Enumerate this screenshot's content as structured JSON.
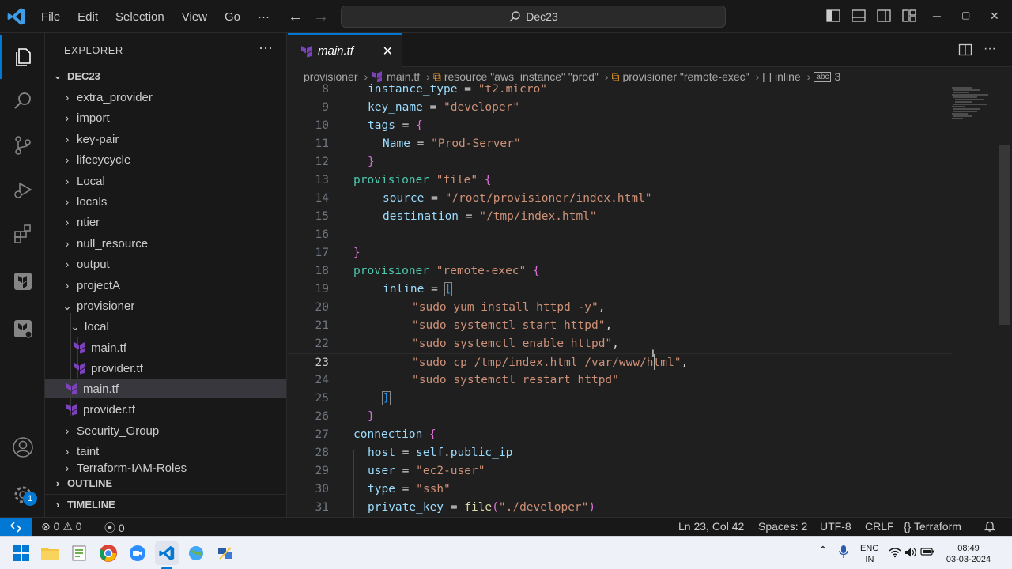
{
  "titlebar": {
    "menu": [
      "File",
      "Edit",
      "Selection",
      "View",
      "Go",
      "···"
    ],
    "search": "Dec23"
  },
  "sidebar": {
    "header": "EXPLORER",
    "more": "···",
    "root": "DEC23",
    "items": [
      {
        "label": "extra_provider"
      },
      {
        "label": "import"
      },
      {
        "label": "key-pair"
      },
      {
        "label": "lifecycycle"
      },
      {
        "label": "Local"
      },
      {
        "label": "locals"
      },
      {
        "label": "ntier"
      },
      {
        "label": "null_resource"
      },
      {
        "label": "output"
      },
      {
        "label": "projectA"
      },
      {
        "label": "provisioner"
      },
      {
        "label": "local"
      },
      {
        "label": "main.tf"
      },
      {
        "label": "provider.tf"
      },
      {
        "label": "main.tf"
      },
      {
        "label": "provider.tf"
      },
      {
        "label": "Security_Group"
      },
      {
        "label": "taint"
      },
      {
        "label": "Terraform-IAM-Roles"
      }
    ],
    "outline": "OUTLINE",
    "timeline": "TIMELINE",
    "accounts_badge": "1"
  },
  "tabs": {
    "active": "main.tf",
    "close": "✕"
  },
  "breadcrumb": {
    "folder": "provisioner",
    "file": "main.tf",
    "resource": "resource \"aws_instance\" \"prod\"",
    "provisioner": "provisioner \"remote-exec\"",
    "inline": "inline",
    "index": "3"
  },
  "editor": {
    "lines": [
      {
        "n": "8",
        "text": "instance_type = \"t2.micro\""
      },
      {
        "n": "9",
        "text": "key_name = \"developer\""
      },
      {
        "n": "10",
        "text": "tags = {"
      },
      {
        "n": "11",
        "text": "Name = \"Prod-Server\""
      },
      {
        "n": "12",
        "text": "}"
      },
      {
        "n": "13",
        "text": "provisioner \"file\" {"
      },
      {
        "n": "14",
        "text": "source = \"/root/provisioner/index.html\""
      },
      {
        "n": "15",
        "text": "destination = \"/tmp/index.html\""
      },
      {
        "n": "16",
        "text": ""
      },
      {
        "n": "17",
        "text": "}"
      },
      {
        "n": "18",
        "text": "provisioner \"remote-exec\" {"
      },
      {
        "n": "19",
        "text": "inline = ["
      },
      {
        "n": "20",
        "text": "\"sudo yum install httpd -y\","
      },
      {
        "n": "21",
        "text": "\"sudo systemctl start httpd\","
      },
      {
        "n": "22",
        "text": "\"sudo systemctl enable httpd\","
      },
      {
        "n": "23",
        "text": "\"sudo cp /tmp/index.html /var/www/html\","
      },
      {
        "n": "24",
        "text": "\"sudo systemctl restart httpd\""
      },
      {
        "n": "25",
        "text": "]"
      },
      {
        "n": "26",
        "text": "}"
      },
      {
        "n": "27",
        "text": "connection {"
      },
      {
        "n": "28",
        "text": "host = self.public_ip"
      },
      {
        "n": "29",
        "text": "user = \"ec2-user\""
      },
      {
        "n": "30",
        "text": "type = \"ssh\""
      },
      {
        "n": "31",
        "text": "private_key = file(\"./developer\")"
      }
    ]
  },
  "status": {
    "errors": "0",
    "warnings": "0",
    "ports": "0",
    "position": "Ln 23, Col 42",
    "spaces": "Spaces: 2",
    "encoding": "UTF-8",
    "eol": "CRLF",
    "language": "Terraform"
  },
  "taskbar": {
    "lang_top": "ENG",
    "lang_bottom": "IN",
    "time": "08:49",
    "date": "03-03-2024"
  },
  "colors": {
    "accent": "#0078d4",
    "terraform": "#7b42bc",
    "string": "#ce9178",
    "attribute": "#9cdcfe",
    "block_type": "#4ec9b0"
  }
}
